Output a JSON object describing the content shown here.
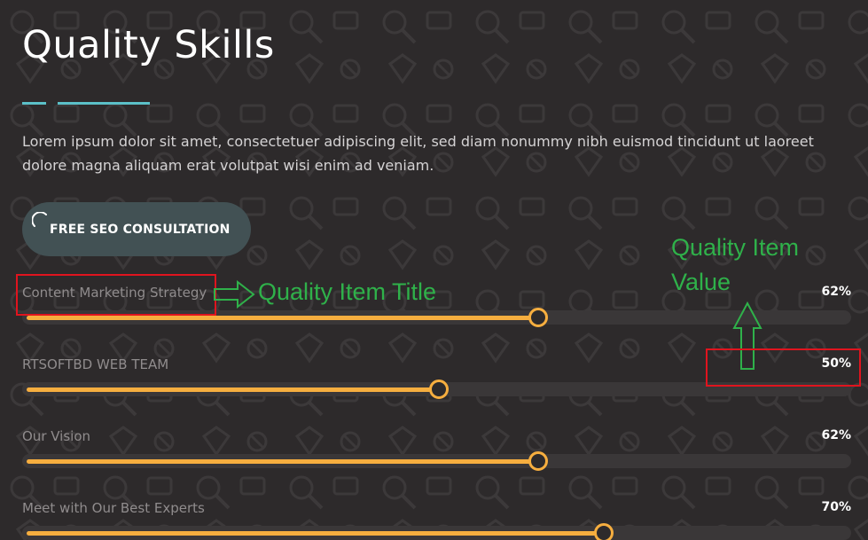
{
  "section": {
    "title": "Quality Skills",
    "description": "Lorem ipsum dolor sit amet, consectetuer adipiscing elit, sed diam nonummy nibh euismod tincidunt ut laoreet dolore magna aliquam erat volutpat wisi enim ad veniam.",
    "accent_color": "#5bc0c8"
  },
  "cta": {
    "label": "FREE SEO CONSULTATION"
  },
  "skills": [
    {
      "title": "Content Marketing Strategy",
      "value": "62%",
      "level": 0.62
    },
    {
      "title": "RTSOFTBD WEB TEAM",
      "value": "50%",
      "level": 0.5
    },
    {
      "title": "Our Vision",
      "value": "62%",
      "level": 0.62
    },
    {
      "title": "Meet with Our Best Experts",
      "value": "70%",
      "level": 0.7
    }
  ],
  "bar_color": "#f6ae3f",
  "annotations": {
    "item_title_label": "Quality Item Title",
    "item_value_label_line1": "Quality Item",
    "item_value_label_line2": "Value",
    "box_color": "#e0141e",
    "text_color": "#2fb14a"
  }
}
